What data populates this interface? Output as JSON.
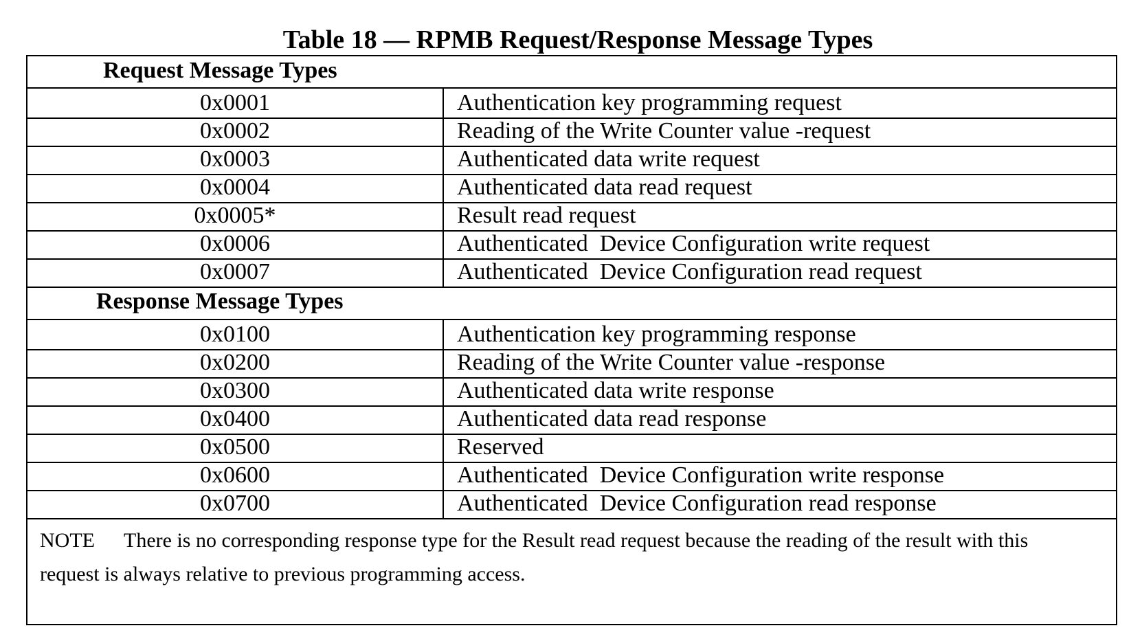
{
  "title": "Table 18 — RPMB Request/Response Message Types",
  "request_section": {
    "label": "Request Message Types",
    "rows": [
      {
        "code": "0x0001",
        "description": "Authentication key programming request"
      },
      {
        "code": "0x0002",
        "description": "Reading of the Write Counter value -request"
      },
      {
        "code": "0x0003",
        "description": "Authenticated data write request"
      },
      {
        "code": "0x0004",
        "description": "Authenticated data read request"
      },
      {
        "code": "0x0005*",
        "description": "Result read request"
      },
      {
        "code": "0x0006",
        "description": "Authenticated  Device Configuration write request"
      },
      {
        "code": "0x0007",
        "description": "Authenticated  Device Configuration read request"
      }
    ]
  },
  "response_section": {
    "label": "Response Message Types",
    "rows": [
      {
        "code": "0x0100",
        "description": "Authentication key programming response"
      },
      {
        "code": "0x0200",
        "description": "Reading of the Write Counter value -response"
      },
      {
        "code": "0x0300",
        "description": "Authenticated data write response"
      },
      {
        "code": "0x0400",
        "description": "Authenticated data read response"
      },
      {
        "code": "0x0500",
        "description": "Reserved"
      },
      {
        "code": "0x0600",
        "description": "Authenticated  Device Configuration write response"
      },
      {
        "code": "0x0700",
        "description": "Authenticated  Device Configuration read response"
      }
    ]
  },
  "note": {
    "label": "NOTE",
    "text": "There is no corresponding response type for the Result read request because the reading of the result with this request is always relative to previous programming access."
  }
}
